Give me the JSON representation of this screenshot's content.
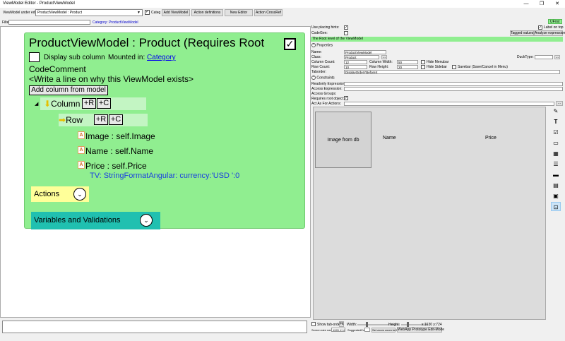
{
  "window": {
    "title": "ViewModel Editor - ProductViewModel",
    "minimize_glyph": "—",
    "maximize_glyph": "❐",
    "close_glyph": "✕"
  },
  "toolbar": {
    "vm_label": "ViewModel under edit:",
    "vm_selected": "ProductViewModel : Product",
    "categ_label": "Categ",
    "add_viewmodel": "Add ViewModel",
    "action_definitions": "Action definitions",
    "new_editor": "New Editor",
    "action_crossref": "Action CrossRef"
  },
  "filter": {
    "label": "Filter",
    "value": "",
    "category_link": "Category: ProductViewModel"
  },
  "canvas": {
    "title": "ProductViewModel : Product  (Requires Root",
    "requires_root_checked": "✓",
    "display_sub_column": "Display sub column",
    "mounted_in_label": "Mounted in: ",
    "mounted_in_link": "Category",
    "code_comment_label": "CodeComment",
    "code_comment_text": "<Write a line on why this ViewModel exists>",
    "add_column_button": "Add column from model",
    "tree": {
      "column_label": "Column",
      "row_label": "Row",
      "plus_r": "+R",
      "plus_c": "+C",
      "attr_icon": "A",
      "image_node": "Image : self.Image",
      "name_node": "Name : self.Name",
      "price_node": "Price : self.Price",
      "price_tv": "TV: StringFormatAngular: currency:'USD  ':0"
    },
    "actions_label": "Actions",
    "variables_label": "Variables and Validations"
  },
  "right": {
    "ufirst": "UFirst",
    "use_placing_hints": "Use placing hints:",
    "label_on_top": "Label on top",
    "codegen": "CodeGen:",
    "tagged_values": "Tagged values",
    "analyze_expressions": "Analyze expressions",
    "root_level_text": "The Root level of the ViewModel",
    "properties_header": "Properties",
    "props": {
      "name_label": "Name:",
      "name_value": "ProductViewModel",
      "class_label": "Class:",
      "class_value": "Product",
      "ducktype_label": "DuckType:",
      "column_count_label": "Column Count:",
      "column_count_value": "12",
      "column_width_label": "Column Width:",
      "column_width_value": "50",
      "hide_menubar": "Hide Menubar",
      "row_count_label": "Row Count:",
      "row_count_value": "10",
      "row_height_label": "Row Height:",
      "row_height_value": "20",
      "hide_sidebar": "Hide Sidebar",
      "savebar": "Savebar (Save/Cancel in Menu)",
      "taborder_label": "Taborder:",
      "taborder_value": "DisplayOrderYBeforeX"
    },
    "constraints_header": "Constraints",
    "cons": {
      "readonly_expr": "Readonly Expression:",
      "access_expr": "Access Expression:",
      "access_groups": "Access Groups:",
      "requires_root": "Requires root object:",
      "act_as_for": "Act As For Actions:"
    },
    "preview": {
      "image_from_db": "Image from db",
      "name_header": "Name",
      "price_header": "Price"
    },
    "icons": [
      "edit-icon",
      "text-icon",
      "checkbox-icon",
      "table-icon",
      "calendar-icon",
      "list-icon",
      "button-icon",
      "panel-icon",
      "image-icon",
      "viewmodel-icon"
    ],
    "bottom": {
      "show_tab_order": "Show tab-order",
      "fit": "Fit",
      "width_label": "Width:",
      "height_label": "Height:",
      "size_readout": "x:1630 y:724",
      "screen_size_label": "Screen size name:",
      "screen_size_value": "1920 X 1080",
      "suggested_zoom_label": "SuggestedZoom:",
      "set_zoom": "Set zoom zoom to fit",
      "webapp_prototype": "WebApp Prototype Edit-Mode"
    }
  }
}
